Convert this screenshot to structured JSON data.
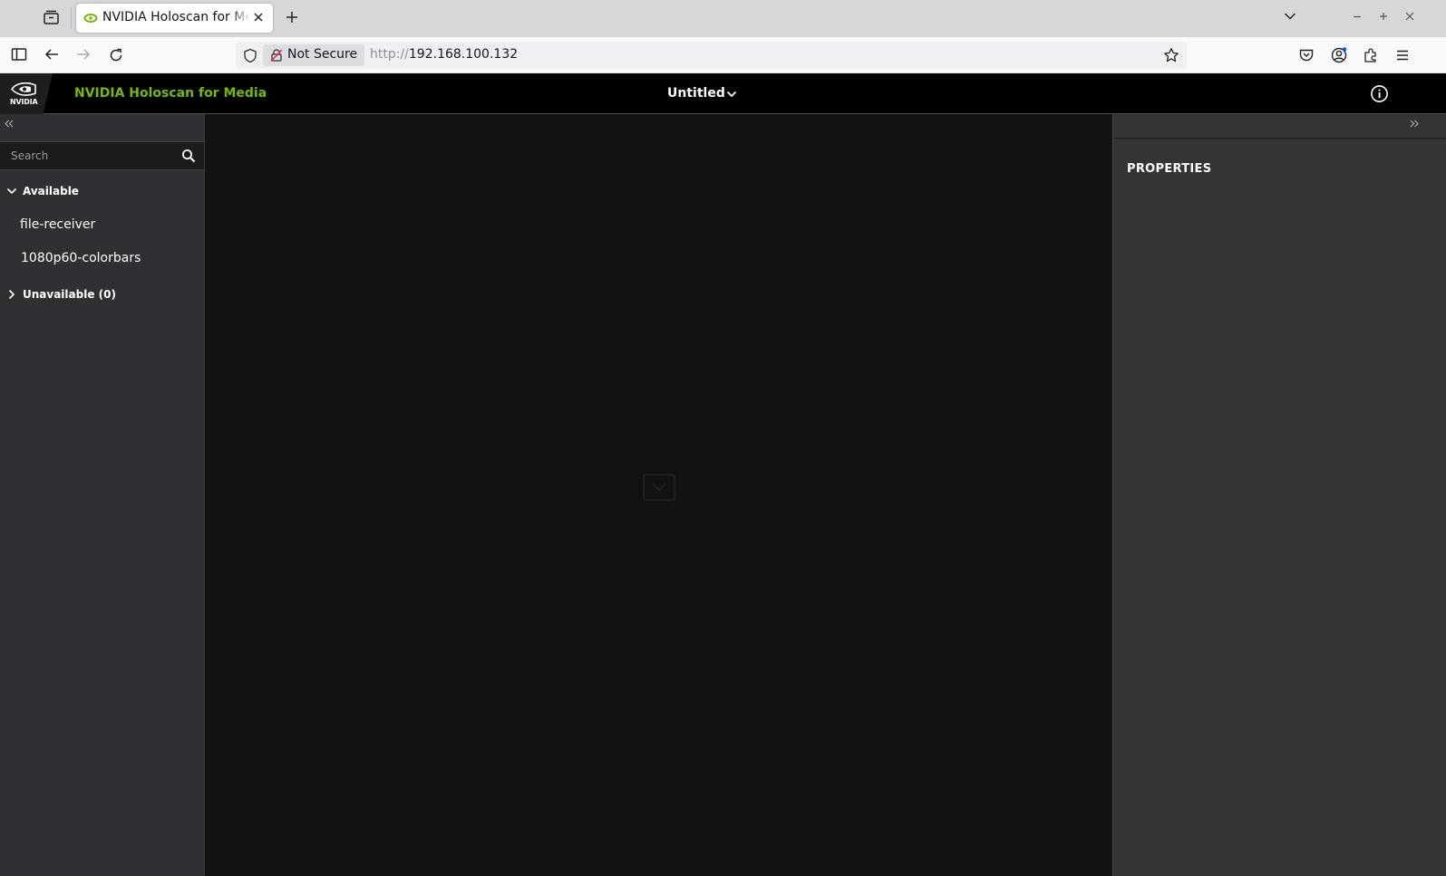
{
  "browser": {
    "tab_title": "NVIDIA Holoscan for Media",
    "security_label": "Not Secure",
    "url_scheme": "http://",
    "url_host": "192.168.100.132"
  },
  "app": {
    "brand_label": "NVIDIA",
    "title": "NVIDIA Holoscan for Media",
    "document_title": "Untitled",
    "accent_color": "#76b900"
  },
  "sidebar": {
    "search_placeholder": "Search",
    "available_label": "Available",
    "available_items": [
      {
        "label": "file-receiver"
      },
      {
        "label": "1080p60-colorbars"
      }
    ],
    "unavailable_label": "Unavailable (0)"
  },
  "properties": {
    "title": "PROPERTIES"
  }
}
